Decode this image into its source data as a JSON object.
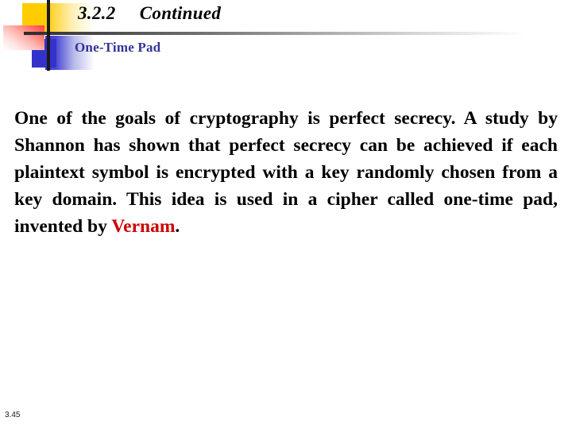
{
  "slide": {
    "title": "3.2.2     Continued",
    "subtitle": "One-Time Pad",
    "page_number": "3.45",
    "body": {
      "text_before_highlight": "One of the goals of cryptography is perfect secrecy. A study by Shannon has shown that perfect secrecy can be achieved if each plaintext symbol is encrypted with a key randomly chosen from a key domain. This idea is used in a cipher called one-time pad, invented by ",
      "highlight": "Vernam",
      "text_after_highlight": "."
    }
  },
  "colors": {
    "title_text": "#000000",
    "subtitle_text": "#333399",
    "body_text": "#000000",
    "highlight_text": "#cc0000",
    "deco_yellow": "#ffcc00",
    "deco_blue": "#3333cc",
    "deco_red": "#ff4040",
    "deco_line": "#1a1a1a",
    "background": "#ffffff"
  }
}
